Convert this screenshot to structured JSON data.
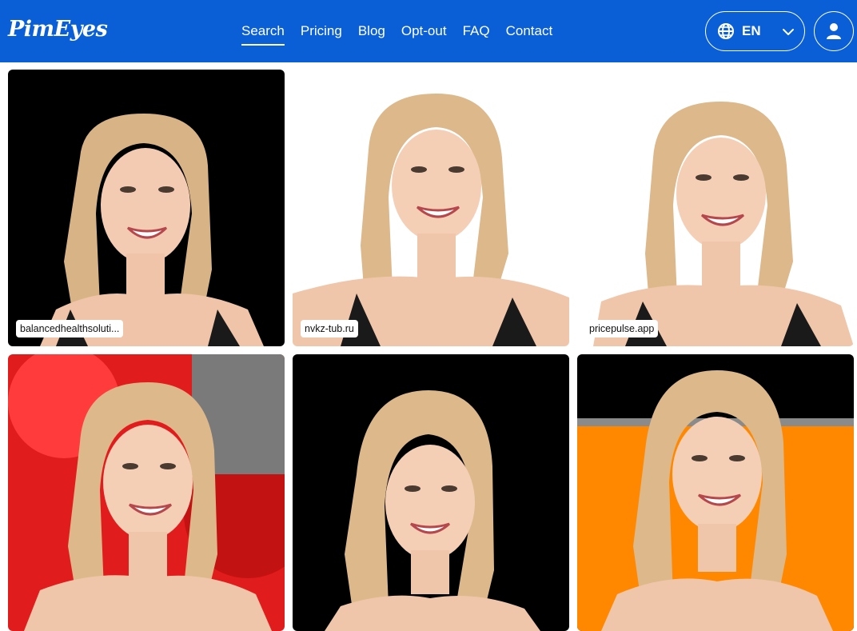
{
  "header": {
    "logo": "PimEyes",
    "nav": [
      {
        "label": "Search",
        "active": true
      },
      {
        "label": "Pricing"
      },
      {
        "label": "Blog"
      },
      {
        "label": "Opt-out"
      },
      {
        "label": "FAQ"
      },
      {
        "label": "Contact"
      }
    ],
    "language": {
      "label": "EN",
      "icon": "globe-icon"
    },
    "account_icon": "user-icon",
    "background": "#0a5fd6"
  },
  "results": [
    {
      "domain": "balancedhealthsoluti...",
      "background": "#000000"
    },
    {
      "domain": "nvkz-tub.ru",
      "background": "#ffffff"
    },
    {
      "domain": "pricepulse.app",
      "background": "#ffffff"
    },
    {
      "domain": "",
      "background": "#e11c1c"
    },
    {
      "domain": "",
      "background": "#000000"
    },
    {
      "domain": "",
      "background": "#ff8800"
    }
  ]
}
